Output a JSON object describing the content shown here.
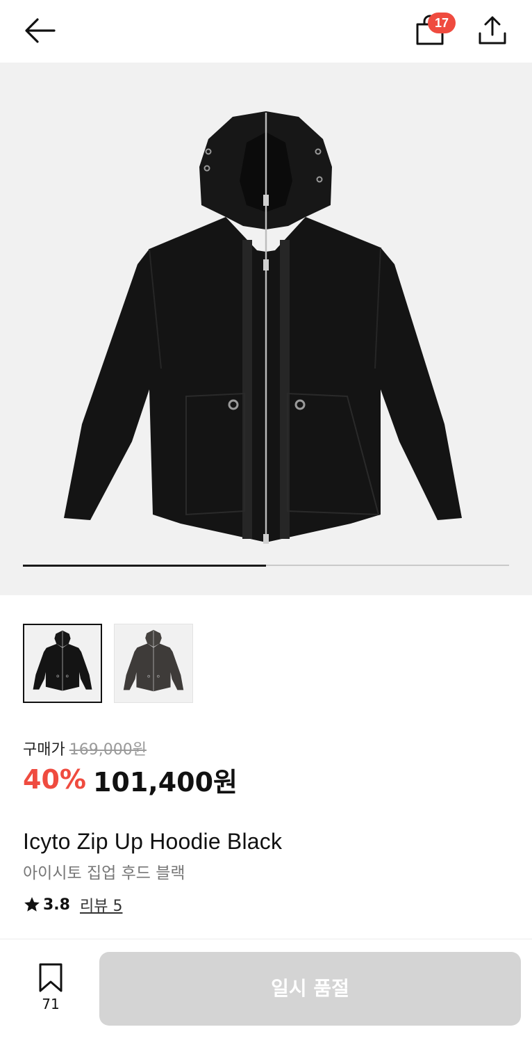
{
  "header": {
    "back_icon": "arrow-left-icon",
    "cart_icon": "shopping-bag-icon",
    "cart_count": "17",
    "share_icon": "share-upload-icon",
    "badge_color": "#ef4b3f"
  },
  "gallery": {
    "main_image": "black-zip-up-hoodie-photo",
    "progress": 0.5,
    "thumbnails": [
      {
        "name": "thumbnail-black",
        "selected": true
      },
      {
        "name": "thumbnail-charcoal",
        "selected": false
      }
    ]
  },
  "price": {
    "label": "구매가",
    "original": "169,000원",
    "discount": "40%",
    "sale": "101,400원",
    "discount_color": "#ef4b3f"
  },
  "product": {
    "name_en": "Icyto Zip Up Hoodie Black",
    "name_ko": "아이시토 집업 후드 블랙",
    "rating": "3.8",
    "reviews": "리뷰 5"
  },
  "bottom_bar": {
    "bookmark_icon": "bookmark-icon",
    "bookmark_count": "71",
    "action_label": "일시 품절"
  }
}
